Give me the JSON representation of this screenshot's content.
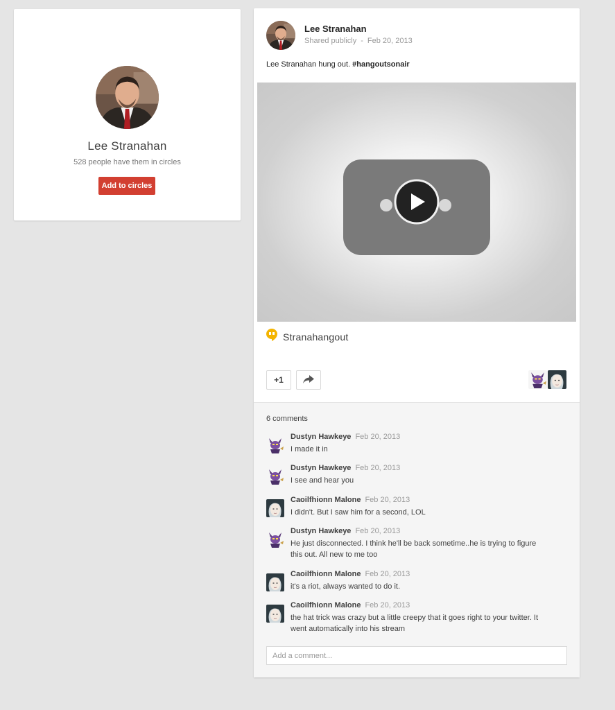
{
  "profile": {
    "name": "Lee Stranahan",
    "circles_text": "528 people have them in circles",
    "add_button": "Add to circles"
  },
  "post": {
    "author": "Lee Stranahan",
    "visibility": "Shared publicly",
    "separator": "-",
    "date": "Feb 20, 2013",
    "text": "Lee Stranahan hung out.",
    "hashtag": "#hangoutsonair",
    "hangout_title": "Stranahangout",
    "plus_one_label": "+1"
  },
  "comments": {
    "count_label": "6 comments",
    "items": [
      {
        "author": "Dustyn Hawkeye",
        "date": "Feb 20, 2013",
        "line1": "I made it in",
        "line2": ""
      },
      {
        "author": "Dustyn Hawkeye",
        "date": "Feb 20, 2013",
        "line1": "I see and hear you",
        "line2": ""
      },
      {
        "author": "Caoilfhionn Malone",
        "date": "Feb 20, 2013",
        "line1": "I didn't. But I saw him for a second, LOL",
        "line2": ""
      },
      {
        "author": "Dustyn Hawkeye",
        "date": "Feb 20, 2013",
        "line1": "He just disconnected.  I think he'll be back sometime..he is trying to figure",
        "line2": "this out.  All new to me too"
      },
      {
        "author": "Caoilfhionn Malone",
        "date": "Feb 20, 2013",
        "line1": "it's a riot, always wanted to do it.",
        "line2": ""
      },
      {
        "author": "Caoilfhionn Malone",
        "date": "Feb 20, 2013",
        "line1": "the hat trick was crazy but a little creepy that it goes right to your twitter. It",
        "line2": "went automatically into his stream"
      }
    ],
    "add_placeholder": "Add a comment..."
  },
  "colors": {
    "background": "#e5e5e5",
    "add_button": "#d23f31",
    "hangout_icon": "#f4b400"
  }
}
